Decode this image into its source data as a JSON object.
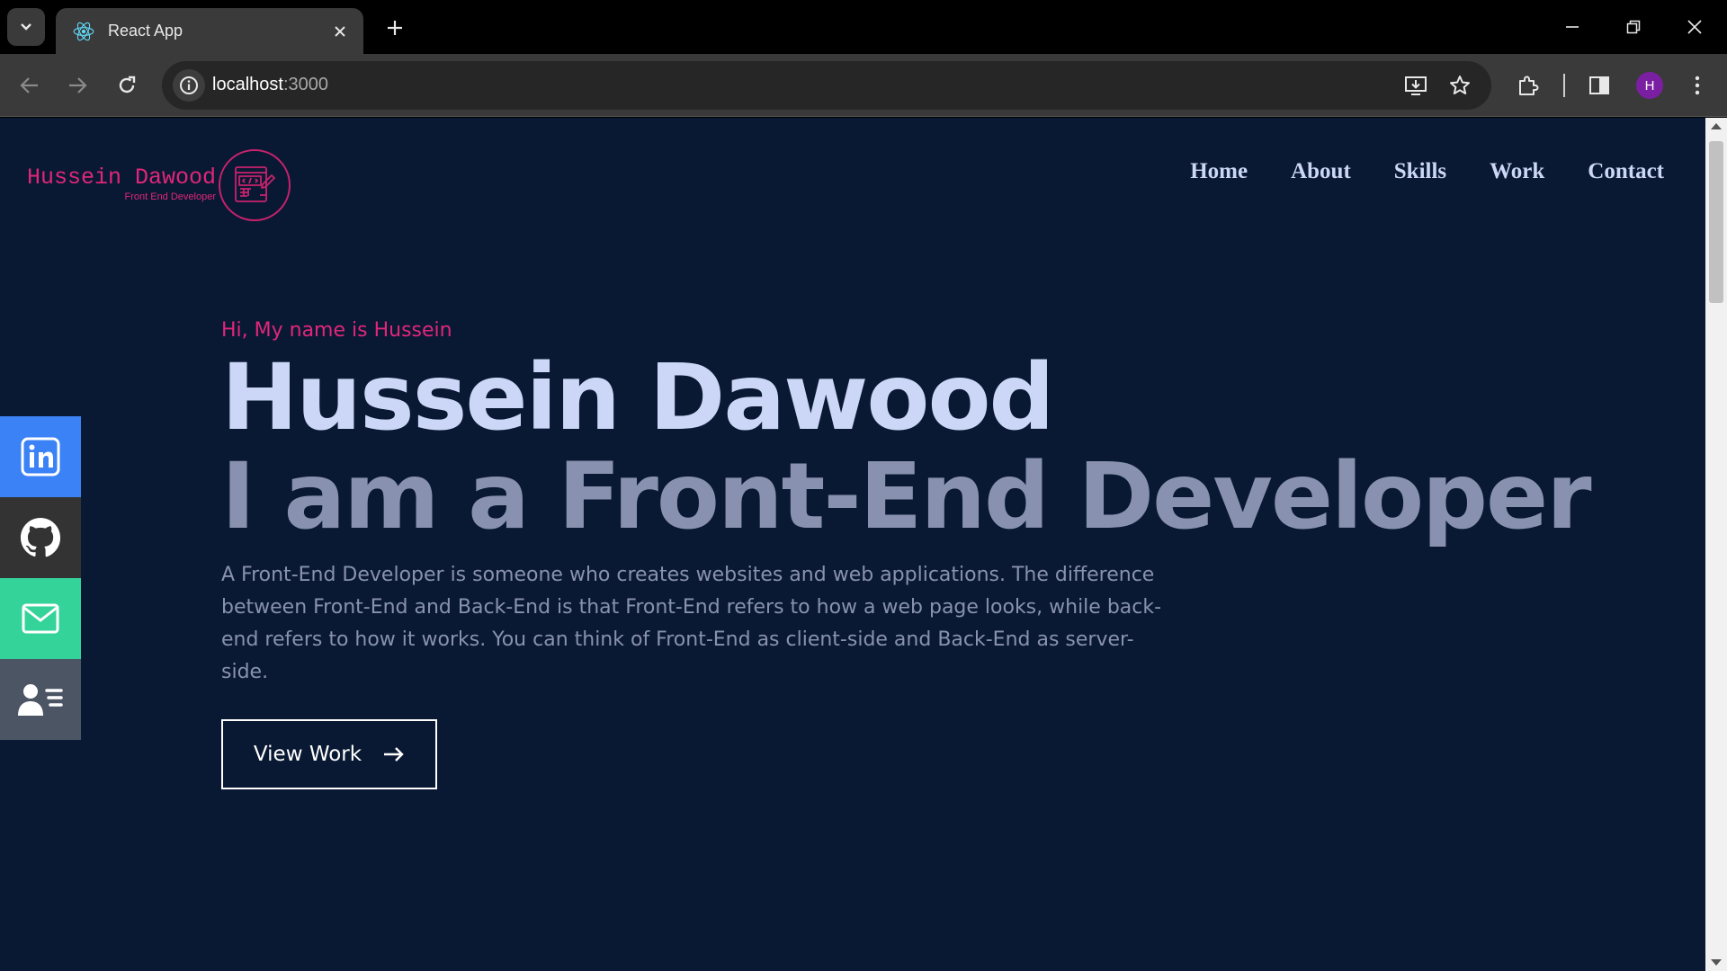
{
  "browser": {
    "tab_title": "React App",
    "url_host": "localhost",
    "url_port": ":3000",
    "profile_initial": "H",
    "icons": [
      "tab-search-icon",
      "react-icon",
      "close-icon",
      "plus-icon",
      "minimize-icon",
      "restore-icon",
      "close-icon",
      "back-icon",
      "forward-icon",
      "reload-icon",
      "info-icon",
      "install-icon",
      "star-icon",
      "extensions-icon",
      "side-panel-icon",
      "kebab-menu-icon"
    ]
  },
  "site": {
    "brand_name": "Hussein Dawood",
    "brand_role": "Front End Developer",
    "nav": [
      "Home",
      "About",
      "Skills",
      "Work",
      "Contact"
    ]
  },
  "social": [
    {
      "icon": "linkedin-icon",
      "color": "#3b82f6"
    },
    {
      "icon": "github-icon",
      "color": "#333333"
    },
    {
      "icon": "mail-icon",
      "color": "#34d399"
    },
    {
      "icon": "contact-card-icon",
      "color": "#4b5563"
    }
  ],
  "hero": {
    "greeting": "Hi, My name is Hussein",
    "name": "Hussein Dawood",
    "title": "I am a Front-End Developer",
    "description": "A Front-End Developer is someone who creates websites and web applications. The difference between Front-End and Back-End is that Front-End refers to how a web page looks, while back-end refers to how it works. You can think of Front-End as client-side and Back-End as server-side.",
    "button_label": "View Work"
  },
  "colors": {
    "page_bg": "#0a1933",
    "accent": "#e0267a",
    "heading": "#ccd6f6",
    "muted": "#8892b0"
  }
}
